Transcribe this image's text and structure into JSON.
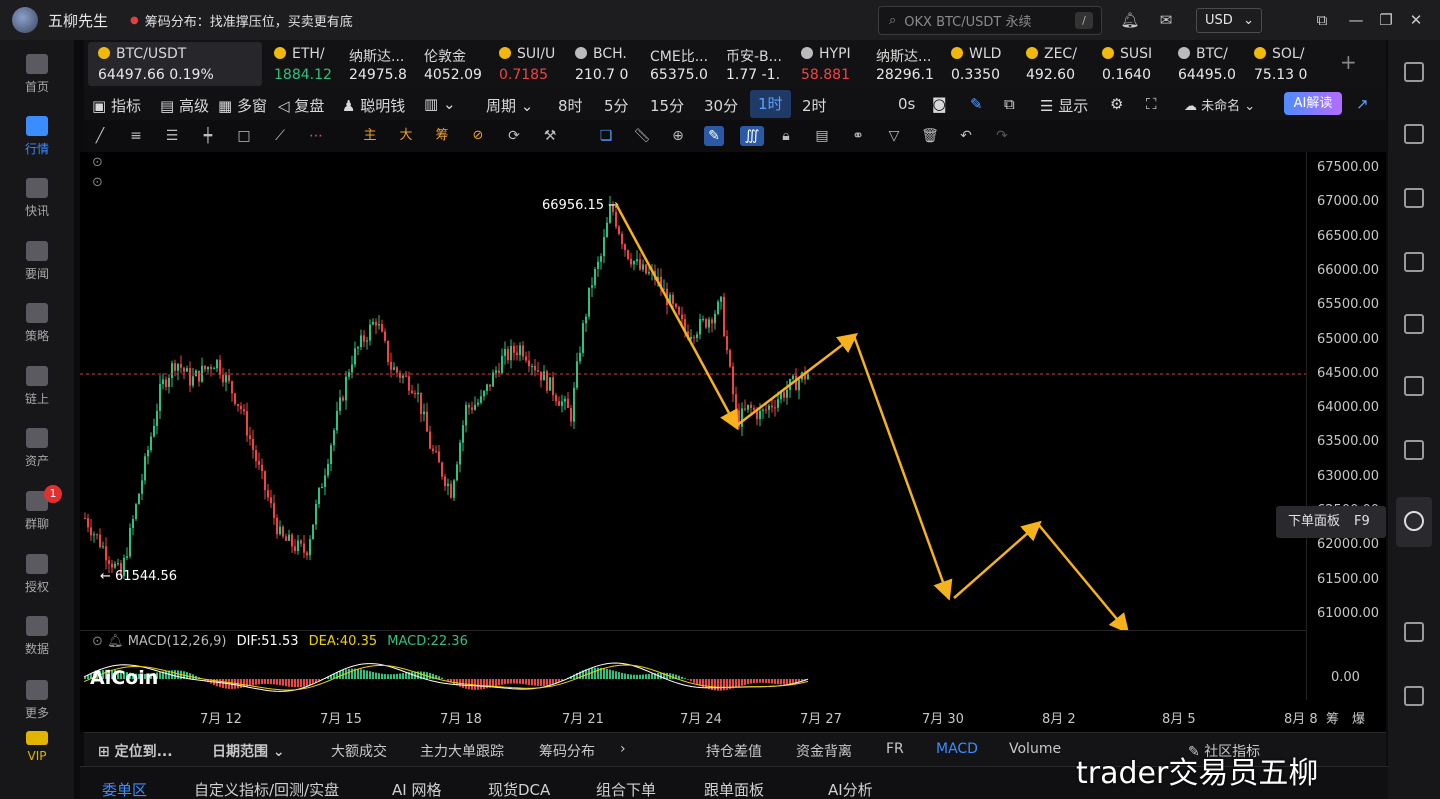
{
  "window": {
    "app_title": "五柳先生",
    "ticker_text": "筹码分布：找准撑压位，买卖更有底",
    "search_placeholder": "OKX BTC/USDT 永续",
    "search_shortcut": "/",
    "currency": "USD"
  },
  "sidebar": {
    "items": [
      {
        "label": "首页",
        "icon": "home-icon"
      },
      {
        "label": "行情",
        "icon": "market-icon"
      },
      {
        "label": "快讯",
        "icon": "news-flash-icon"
      },
      {
        "label": "要闻",
        "icon": "headline-icon"
      },
      {
        "label": "策略",
        "icon": "strategy-icon"
      },
      {
        "label": "链上",
        "icon": "onchain-icon"
      },
      {
        "label": "资产",
        "icon": "wallet-icon"
      },
      {
        "label": "群聊",
        "icon": "chat-icon"
      },
      {
        "label": "授权",
        "icon": "key-icon"
      },
      {
        "label": "数据",
        "icon": "data-icon"
      },
      {
        "label": "更多",
        "icon": "more-icon"
      },
      {
        "label": "VIP",
        "icon": "vip-icon"
      }
    ],
    "chat_badge": "1"
  },
  "quotes": [
    {
      "name": "BTC/USDT",
      "price": "64497.66",
      "change": "0.19%",
      "trend": "up"
    },
    {
      "name": "ETH/",
      "price": "1884.12",
      "trend": "up"
    },
    {
      "name": "纳斯达...",
      "price": "24975.8",
      "trend": "flat"
    },
    {
      "name": "伦敦金",
      "price": "4052.09",
      "trend": "flat"
    },
    {
      "name": "SUI/U",
      "price": "0.7185",
      "trend": "down"
    },
    {
      "name": "BCH.",
      "price": "210.7 0",
      "trend": "flat"
    },
    {
      "name": "CME比...",
      "price": "65375.0",
      "trend": "flat"
    },
    {
      "name": "币安-B...",
      "price": "1.77 -1.",
      "trend": "flat"
    },
    {
      "name": "HYPI",
      "price": "58.881",
      "trend": "down"
    },
    {
      "name": "纳斯达...",
      "price": "28296.1",
      "trend": "flat"
    },
    {
      "name": "WLD",
      "price": "0.3350",
      "trend": "flat"
    },
    {
      "name": "ZEC/",
      "price": "492.60",
      "trend": "flat"
    },
    {
      "name": "SUSI",
      "price": "0.1640",
      "trend": "flat"
    },
    {
      "name": "BTC/",
      "price": "64495.0",
      "trend": "flat"
    },
    {
      "name": "SOL/",
      "price": "75.13 0",
      "trend": "flat"
    }
  ],
  "toolbar": {
    "indicator": "指标",
    "advanced": "高级",
    "multi_window": "多窗",
    "replay": "复盘",
    "smart_money": "聪明钱",
    "period": "周期",
    "intervals": [
      "8时",
      "5分",
      "15分",
      "30分",
      "1时",
      "2时"
    ],
    "selected_interval": "1时",
    "countdown": "0s",
    "display": "显示",
    "unnamed": "未命名",
    "ai_read": "AI解读"
  },
  "drawbar": {
    "main": "主",
    "big": "大",
    "chips": "筹"
  },
  "chart": {
    "y_ticks": [
      "67500.00",
      "67000.00",
      "66500.00",
      "66000.00",
      "65500.00",
      "65000.00",
      "64500.00",
      "64000.00",
      "63500.00",
      "63000.00",
      "62500.00",
      "62000.00",
      "61500.00",
      "61000.00"
    ],
    "macd_zero": "0.00",
    "x_ticks": [
      "7月 12",
      "7月 15",
      "7月 18",
      "7月 21",
      "7月 24",
      "7月 27",
      "7月 30",
      "8月 2",
      "8月 5",
      "8月 8"
    ],
    "high_label": "66956.15",
    "low_label": "61544.56",
    "current_price": 64497.66,
    "logo": "AiCoin"
  },
  "macd": {
    "label": "MACD(12,26,9)",
    "dif": "DIF:51.53",
    "dea": "DEA:40.35",
    "macd": "MACD:22.36"
  },
  "bottom_bar": {
    "locate": "定位到...",
    "date_range": "日期范围",
    "tabs": [
      "大额成交",
      "主力大单跟踪",
      "筹码分布",
      "持仓差值",
      "资金背离",
      "FR",
      "MACD",
      "Volume"
    ],
    "active": "MACD",
    "community": "社区指标"
  },
  "bottom_tabs": {
    "items": [
      "委单区",
      "自定义指标/回测/实盘",
      "AI 网格",
      "现货DCA",
      "组合下单",
      "跟单面板",
      "AI分析"
    ],
    "active": "委单区"
  },
  "right_panel": {
    "order_panel_tip": "下单面板",
    "order_panel_key": "F9"
  },
  "watermark": "trader交易员五柳",
  "colors": {
    "up": "#2ec27e",
    "down": "#ef4444",
    "accent": "#3a8cff",
    "annotation": "#f5b21a"
  }
}
